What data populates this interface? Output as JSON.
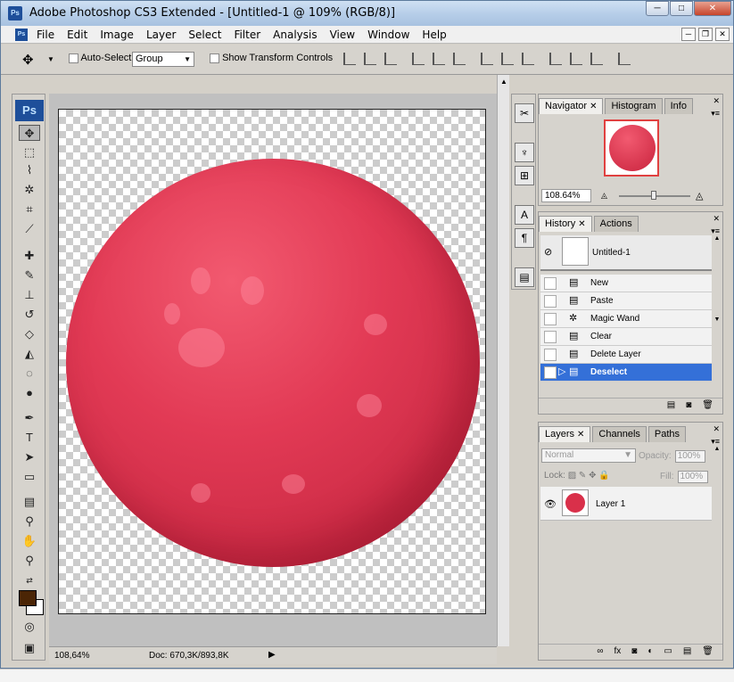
{
  "window": {
    "title": "Adobe Photoshop CS3 Extended - [Untitled-1 @ 109% (RGB/8)]",
    "app_icon_label": "Ps",
    "controls": [
      "─",
      "□",
      "✕"
    ]
  },
  "menu": {
    "items": [
      "File",
      "Edit",
      "Image",
      "Layer",
      "Select",
      "Filter",
      "Analysis",
      "View",
      "Window",
      "Help"
    ],
    "doc_controls": [
      "─",
      "❐",
      "✕"
    ]
  },
  "options": {
    "auto_select_label": "Auto-Select:",
    "auto_select_value": "Group",
    "show_transform_label": "Show Transform Controls"
  },
  "toolbox": {
    "logo": "Ps",
    "tools": [
      "move",
      "marquee",
      "lasso",
      "magic-wand",
      "crop",
      "slice",
      "healing",
      "brush",
      "clone-stamp",
      "history-brush",
      "eraser",
      "paint-bucket",
      "blur",
      "dodge",
      "pen",
      "type",
      "path-selection",
      "shape",
      "notes",
      "eyedropper",
      "hand",
      "zoom"
    ],
    "foreground_color": "#4b2505",
    "background_color": "#ffffff"
  },
  "canvas": {
    "zoom": "108,64%",
    "doc_info": "Doc: 670,3K/893,8K"
  },
  "navigator": {
    "tabs": [
      "Navigator",
      "Histogram",
      "Info"
    ],
    "zoom": "108.64%"
  },
  "history": {
    "tabs": [
      "History",
      "Actions"
    ],
    "snapshot_label": "Untitled-1",
    "steps": [
      "New",
      "Paste",
      "Magic Wand",
      "Clear",
      "Delete Layer",
      "Deselect"
    ],
    "selected_step": "Deselect"
  },
  "layers": {
    "tabs": [
      "Layers",
      "Channels",
      "Paths"
    ],
    "blend_mode": "Normal",
    "opacity_label": "Opacity:",
    "opacity_value": "100%",
    "lock_label": "Lock:",
    "fill_label": "Fill:",
    "fill_value": "100%",
    "items": [
      {
        "name": "Layer 1",
        "visible": true
      }
    ]
  }
}
